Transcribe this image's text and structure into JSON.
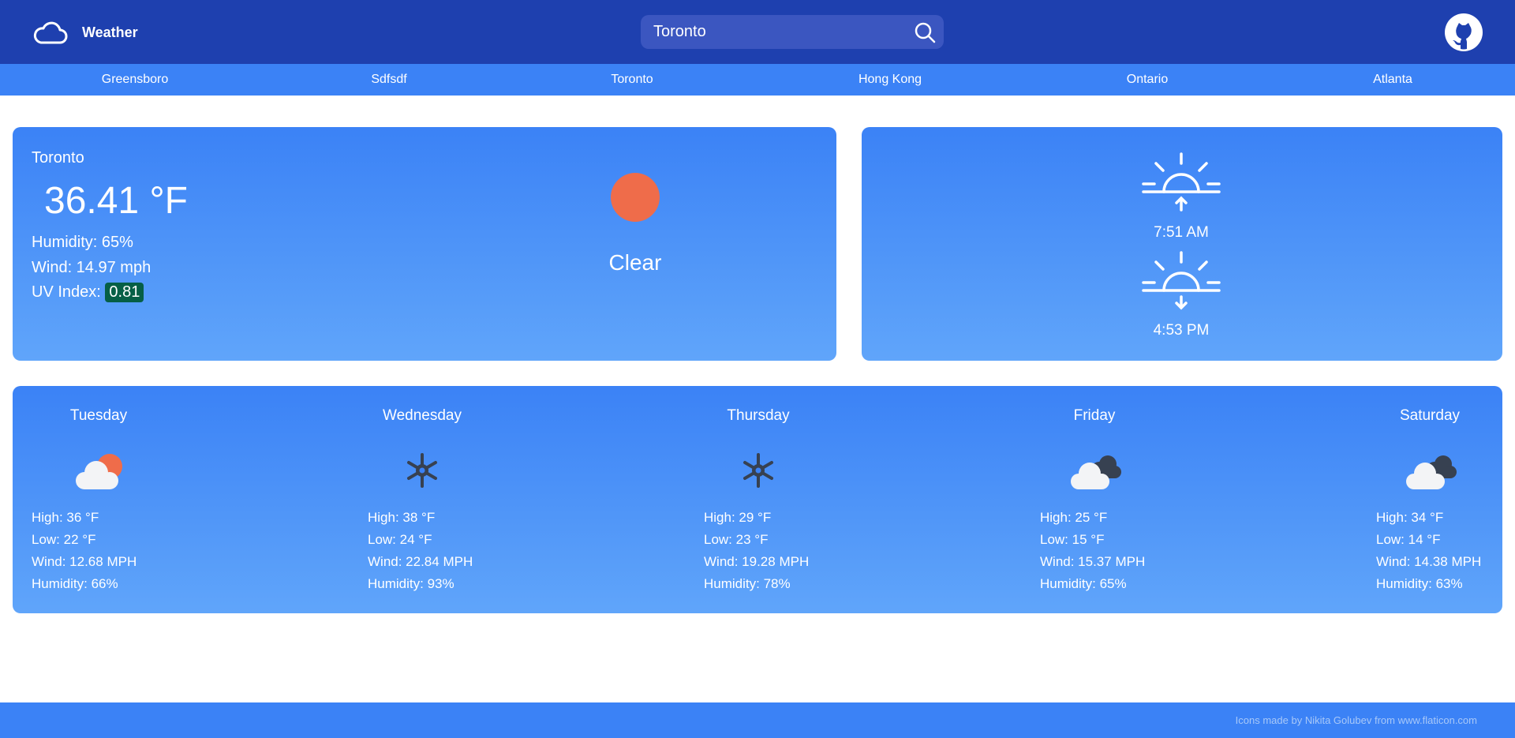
{
  "header": {
    "title": "Weather",
    "logo_icon": "cloud-outline-icon",
    "search": {
      "value": "Toronto",
      "placeholder": ""
    },
    "github_icon": "github-icon"
  },
  "cities": [
    "Greensboro",
    "Sdfsdf",
    "Toronto",
    "Hong Kong",
    "Ontario",
    "Atlanta"
  ],
  "current": {
    "location": "Toronto",
    "temperature": "36.41 °F",
    "humidity": "Humidity: 65%",
    "wind": "Wind: 14.97 mph",
    "uv_label": "UV Index:",
    "uv_value": "0.81",
    "uv_color": "#065f46",
    "condition": "Clear",
    "condition_icon": "sun-icon"
  },
  "sun": {
    "sunrise": "7:51 AM",
    "sunset": "4:53 PM"
  },
  "forecast": [
    {
      "day": "Tuesday",
      "icon": "partly-cloudy-day-icon",
      "high": "High: 36 °F",
      "low": "Low: 22 °F",
      "wind": "Wind: 12.68 MPH",
      "humidity": "Humidity: 66%"
    },
    {
      "day": "Wednesday",
      "icon": "snowflake-icon",
      "high": "High: 38 °F",
      "low": "Low: 24 °F",
      "wind": "Wind: 22.84 MPH",
      "humidity": "Humidity: 93%"
    },
    {
      "day": "Thursday",
      "icon": "snowflake-icon",
      "high": "High: 29 °F",
      "low": "Low: 23 °F",
      "wind": "Wind: 19.28 MPH",
      "humidity": "Humidity: 78%"
    },
    {
      "day": "Friday",
      "icon": "cloudy-icon",
      "high": "High: 25 °F",
      "low": "Low: 15 °F",
      "wind": "Wind: 15.37 MPH",
      "humidity": "Humidity: 65%"
    },
    {
      "day": "Saturday",
      "icon": "cloudy-icon",
      "high": "High: 34 °F",
      "low": "Low: 14 °F",
      "wind": "Wind: 14.38 MPH",
      "humidity": "Humidity: 63%"
    }
  ],
  "footer": {
    "credit": "Icons made by Nikita Golubev from www.flaticon.com"
  },
  "colors": {
    "header": "#1e40af",
    "accent": "#3b82f6",
    "sun": "#ef6c4a",
    "uv_badge": "#065f46"
  }
}
